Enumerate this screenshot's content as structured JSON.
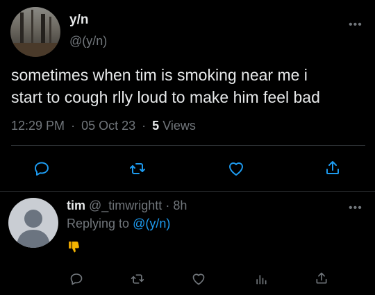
{
  "main_tweet": {
    "display_name": "y/n",
    "handle": "@(y/n)",
    "text_line1": "sometimes when tim is smoking near me i",
    "text_line2": "start to cough rlly loud to make him feel bad",
    "time": "12:29 PM",
    "sep": "·",
    "date": "05 Oct 23",
    "views_count": "5",
    "views_label": "Views",
    "more": "•••"
  },
  "reply": {
    "display_name": "tim",
    "handle": "@_timwrightt",
    "sep": "·",
    "age": "8h",
    "replying_prefix": "Replying to",
    "replying_handle": "@(y/n)",
    "emoji": "👎",
    "more": "•••"
  },
  "colors": {
    "accent": "#1d9bf0",
    "muted": "#71767b",
    "text": "#e7e9ea",
    "emoji": "#f4b400"
  },
  "icons": {
    "main_actions": [
      "reply-icon",
      "retweet-icon",
      "like-icon",
      "share-icon"
    ],
    "reply_actions": [
      "reply-icon",
      "retweet-icon",
      "like-icon",
      "views-icon",
      "share-icon"
    ]
  }
}
